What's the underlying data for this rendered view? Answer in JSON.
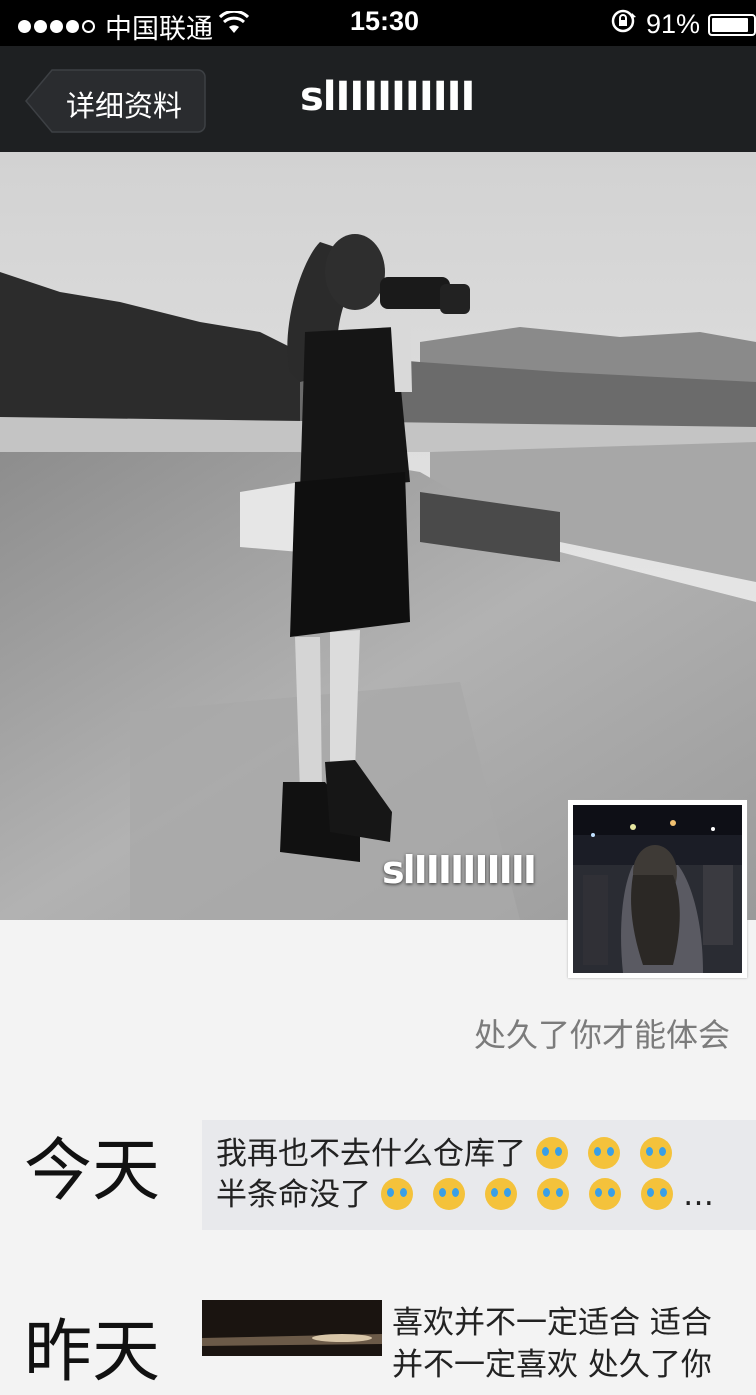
{
  "status_bar": {
    "carrier": "中国联通",
    "time": "15:30",
    "battery": "91%",
    "battery_level": 0.91
  },
  "nav": {
    "back_label": "详细资料",
    "title": "slIIIIIIIIII"
  },
  "profile": {
    "cover_name": "slIIIIIIIIII",
    "signature": "处久了你才能体会"
  },
  "timeline": [
    {
      "day": "今天",
      "text_line1": "我再也不去什么仓库了",
      "text_line2": "半条命没了",
      "ellipsis": "…"
    },
    {
      "day": "昨天",
      "text": "喜欢并不一定适合 适合并不一定喜欢 处久了你"
    }
  ],
  "icons": [
    "wifi-icon",
    "lock-rotation-icon",
    "battery-icon",
    "back-arrow-icon",
    "crying-face-emoji"
  ],
  "colors": {
    "navbar": "#1e2022",
    "post_bg": "#e8e9ec",
    "signature": "#7b7b7b"
  }
}
